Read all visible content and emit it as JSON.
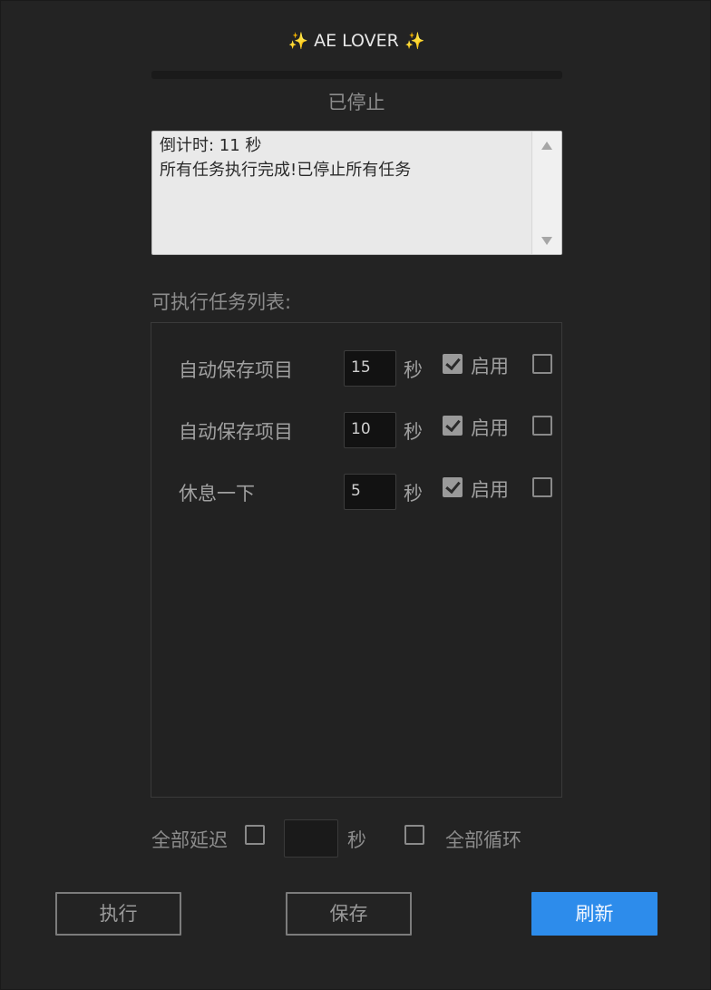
{
  "header": {
    "title": "AE LOVER",
    "left_sparkle": "✨",
    "right_sparkle": "✨"
  },
  "progress": {
    "fraction": 0
  },
  "status_text": "已停止",
  "log": {
    "lines": [
      "倒计时: 11 秒",
      "所有任务执行完成!已停止所有任务"
    ]
  },
  "task_list": {
    "label": "可执行任务列表:",
    "tasks": [
      {
        "name": "自动保存项目",
        "seconds": "15",
        "unit": "秒",
        "enable_label": "启用",
        "enabled": true,
        "extra_checked": false
      },
      {
        "name": "自动保存项目",
        "seconds": "10",
        "unit": "秒",
        "enable_label": "启用",
        "enabled": true,
        "extra_checked": false
      },
      {
        "name": "休息一下",
        "seconds": "5",
        "unit": "秒",
        "enable_label": "启用",
        "enabled": true,
        "extra_checked": false
      }
    ]
  },
  "bottom": {
    "delay_label": "全部延迟",
    "delay_checked": false,
    "delay_value": "",
    "delay_unit": "秒",
    "loop_checked": false,
    "loop_label": "全部循环"
  },
  "buttons": {
    "run": "执行",
    "save": "保存",
    "refresh": "刷新"
  },
  "colors": {
    "accent": "#2d8ceb",
    "background": "#232323"
  }
}
